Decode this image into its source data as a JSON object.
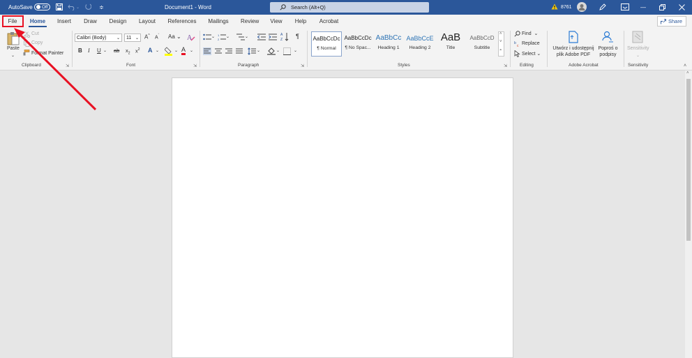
{
  "titlebar": {
    "autosave_label": "AutoSave",
    "autosave_state": "Off",
    "doc_title": "Document1  -  Word",
    "search_placeholder": "Search (Alt+Q)",
    "warning_count": "8761"
  },
  "tabs": [
    "File",
    "Home",
    "Insert",
    "Draw",
    "Design",
    "Layout",
    "References",
    "Mailings",
    "Review",
    "View",
    "Help",
    "Acrobat"
  ],
  "active_tab": "Home",
  "share_label": "Share",
  "clipboard": {
    "paste": "Paste",
    "cut": "Cut",
    "copy": "Copy",
    "format_painter": "Format Painter",
    "group": "Clipboard"
  },
  "font": {
    "name": "Calibri (Body)",
    "size": "11",
    "group": "Font"
  },
  "paragraph": {
    "group": "Paragraph"
  },
  "styles": {
    "group": "Styles",
    "items": [
      {
        "preview": "AaBbCcDc",
        "name": "¶ Normal"
      },
      {
        "preview": "AaBbCcDc",
        "name": "¶ No Spac..."
      },
      {
        "preview": "AaBbCc",
        "name": "Heading 1"
      },
      {
        "preview": "AaBbCcE",
        "name": "Heading 2"
      },
      {
        "preview": "AaB",
        "name": "Title"
      },
      {
        "preview": "AaBbCcD",
        "name": "Subtitle"
      }
    ]
  },
  "editing": {
    "find": "Find",
    "replace": "Replace",
    "select": "Select",
    "group": "Editing"
  },
  "acrobat": {
    "create_line1": "Utwórz i udostępnij",
    "create_line2": "plik Adobe PDF",
    "sign_line1": "Poproś o",
    "sign_line2": "podpisy",
    "group": "Adobe Acrobat"
  },
  "sensitivity": {
    "label": "Sensitivity",
    "group": "Sensitivity"
  },
  "colors": {
    "accent": "#2b579a",
    "highlight_box": "#e81123",
    "arrow": "#e81123"
  }
}
